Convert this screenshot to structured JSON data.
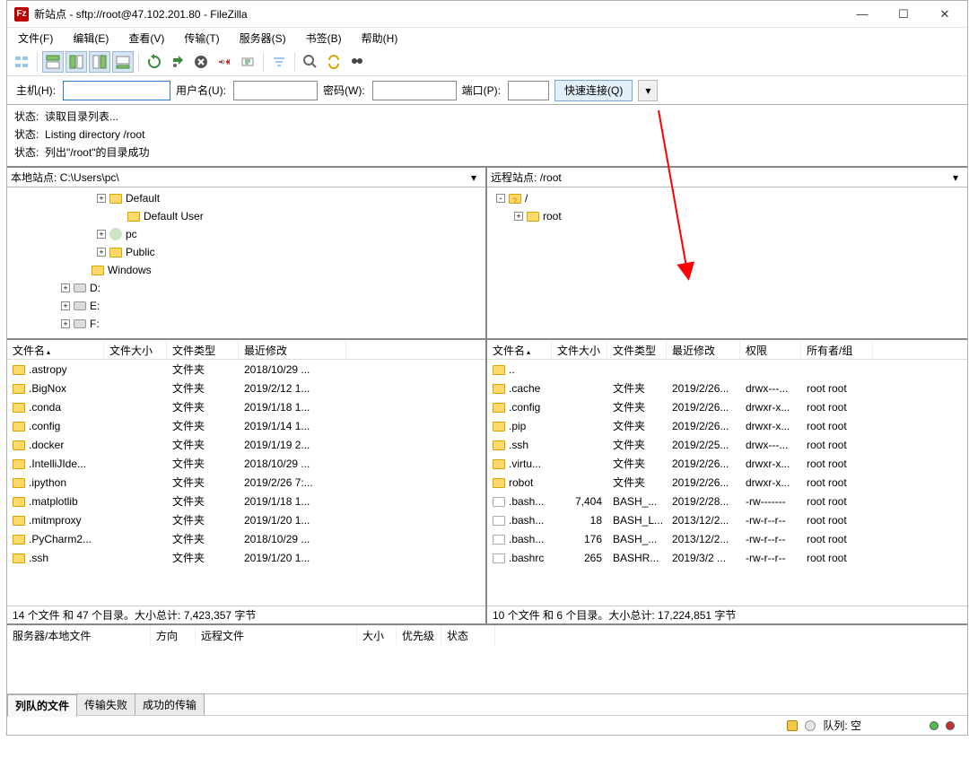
{
  "title": "新站点 - sftp://root@47.102.201.80 - FileZilla",
  "menu": {
    "file": "文件(F)",
    "edit": "编辑(E)",
    "view": "查看(V)",
    "transfer": "传输(T)",
    "server": "服务器(S)",
    "bookmarks": "书签(B)",
    "help": "帮助(H)"
  },
  "quick": {
    "host_label": "主机(H):",
    "host": "",
    "user_label": "用户名(U):",
    "user": "",
    "pass_label": "密码(W):",
    "pass": "",
    "port_label": "端口(P):",
    "port": "",
    "connect_btn": "快速连接(Q)"
  },
  "log": {
    "prefix": "状态:",
    "lines": [
      "读取目录列表...",
      "Listing directory /root",
      "列出\"/root\"的目录成功"
    ]
  },
  "local": {
    "label": "本地站点:",
    "path": "C:\\Users\\pc\\",
    "tree": [
      {
        "indent": 96,
        "expand": "+",
        "icon": "folder",
        "name": "Default"
      },
      {
        "indent": 116,
        "expand": "",
        "icon": "folder",
        "name": "Default User"
      },
      {
        "indent": 96,
        "expand": "+",
        "icon": "user",
        "name": "pc"
      },
      {
        "indent": 96,
        "expand": "+",
        "icon": "folder",
        "name": "Public"
      },
      {
        "indent": 76,
        "expand": "",
        "icon": "folder",
        "name": "Windows"
      },
      {
        "indent": 56,
        "expand": "+",
        "icon": "drive",
        "name": "D:"
      },
      {
        "indent": 56,
        "expand": "+",
        "icon": "drive",
        "name": "E:"
      },
      {
        "indent": 56,
        "expand": "+",
        "icon": "drive",
        "name": "F:"
      }
    ],
    "headers": {
      "name": "文件名",
      "size": "文件大小",
      "type": "文件类型",
      "modified": "最近修改"
    },
    "files": [
      {
        "name": ".astropy",
        "size": "",
        "type": "文件夹",
        "modified": "2018/10/29 ..."
      },
      {
        "name": ".BigNox",
        "size": "",
        "type": "文件夹",
        "modified": "2019/2/12 1..."
      },
      {
        "name": ".conda",
        "size": "",
        "type": "文件夹",
        "modified": "2019/1/18 1..."
      },
      {
        "name": ".config",
        "size": "",
        "type": "文件夹",
        "modified": "2019/1/14 1..."
      },
      {
        "name": ".docker",
        "size": "",
        "type": "文件夹",
        "modified": "2019/1/19 2..."
      },
      {
        "name": ".IntelliJIde...",
        "size": "",
        "type": "文件夹",
        "modified": "2018/10/29 ..."
      },
      {
        "name": ".ipython",
        "size": "",
        "type": "文件夹",
        "modified": "2019/2/26 7:..."
      },
      {
        "name": ".matplotlib",
        "size": "",
        "type": "文件夹",
        "modified": "2019/1/18 1..."
      },
      {
        "name": ".mitmproxy",
        "size": "",
        "type": "文件夹",
        "modified": "2019/1/20 1..."
      },
      {
        "name": ".PyCharm2...",
        "size": "",
        "type": "文件夹",
        "modified": "2018/10/29 ..."
      },
      {
        "name": ".ssh",
        "size": "",
        "type": "文件夹",
        "modified": "2019/1/20 1..."
      }
    ],
    "status": "14 个文件 和 47 个目录。大小总计: 7,423,357 字节"
  },
  "remote": {
    "label": "远程站点:",
    "path": "/root",
    "tree": [
      {
        "indent": 6,
        "expand": "-",
        "icon": "question",
        "name": "/"
      },
      {
        "indent": 26,
        "expand": "+",
        "icon": "folder",
        "name": "root"
      }
    ],
    "headers": {
      "name": "文件名",
      "size": "文件大小",
      "type": "文件类型",
      "modified": "最近修改",
      "perms": "权限",
      "owner": "所有者/组"
    },
    "files": [
      {
        "name": "..",
        "size": "",
        "type": "",
        "modified": "",
        "perms": "",
        "owner": ""
      },
      {
        "name": ".cache",
        "size": "",
        "type": "文件夹",
        "modified": "2019/2/26...",
        "perms": "drwx---...",
        "owner": "root root"
      },
      {
        "name": ".config",
        "size": "",
        "type": "文件夹",
        "modified": "2019/2/26...",
        "perms": "drwxr-x...",
        "owner": "root root"
      },
      {
        "name": ".pip",
        "size": "",
        "type": "文件夹",
        "modified": "2019/2/26...",
        "perms": "drwxr-x...",
        "owner": "root root"
      },
      {
        "name": ".ssh",
        "size": "",
        "type": "文件夹",
        "modified": "2019/2/25...",
        "perms": "drwx---...",
        "owner": "root root"
      },
      {
        "name": ".virtu...",
        "size": "",
        "type": "文件夹",
        "modified": "2019/2/26...",
        "perms": "drwxr-x...",
        "owner": "root root"
      },
      {
        "name": "robot",
        "size": "",
        "type": "文件夹",
        "modified": "2019/2/26...",
        "perms": "drwxr-x...",
        "owner": "root root"
      },
      {
        "name": ".bash...",
        "size": "7,404",
        "type": "BASH_...",
        "modified": "2019/2/28...",
        "perms": "-rw-------",
        "owner": "root root",
        "isFile": true
      },
      {
        "name": ".bash...",
        "size": "18",
        "type": "BASH_L...",
        "modified": "2013/12/2...",
        "perms": "-rw-r--r--",
        "owner": "root root",
        "isFile": true
      },
      {
        "name": ".bash...",
        "size": "176",
        "type": "BASH_...",
        "modified": "2013/12/2...",
        "perms": "-rw-r--r--",
        "owner": "root root",
        "isFile": true
      },
      {
        "name": ".bashrc",
        "size": "265",
        "type": "BASHR...",
        "modified": "2019/3/2 ...",
        "perms": "-rw-r--r--",
        "owner": "root root",
        "isFile": true
      }
    ],
    "status": "10 个文件 和 6 个目录。大小总计: 17,224,851 字节"
  },
  "queue": {
    "headers": [
      "服务器/本地文件",
      "方向",
      "远程文件",
      "大小",
      "优先级",
      "状态"
    ]
  },
  "tabs": {
    "queue": "列队的文件",
    "failed": "传输失败",
    "success": "成功的传输"
  },
  "footer": {
    "queue_label": "队列: 空"
  }
}
